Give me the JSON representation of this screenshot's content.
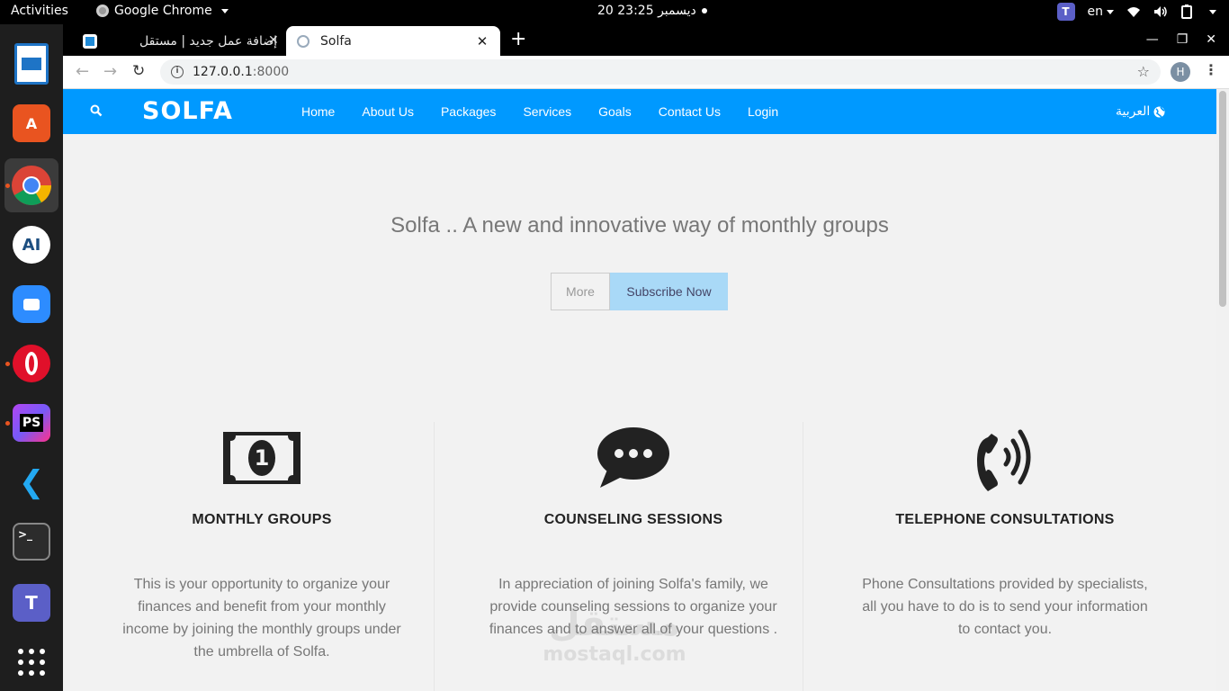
{
  "topbar": {
    "activities": "Activities",
    "app_name": "Google Chrome",
    "clock": "20 ديسمبر 23:25",
    "lang": "en"
  },
  "dock": {
    "apps": [
      "libreoffice-draw",
      "software-center",
      "google-chrome",
      "android-studio",
      "zoom",
      "opera",
      "phpstorm",
      "vscode",
      "terminal",
      "teams",
      "show-applications"
    ]
  },
  "browser": {
    "tabs": [
      {
        "title": "إضافة عمل جديد | مستقل",
        "active": false
      },
      {
        "title": "Solfa",
        "active": true
      }
    ],
    "url_host": "127.0.0.1",
    "url_port": ":8000",
    "profile_initial": "H"
  },
  "site": {
    "brand": "SOLFA",
    "nav": [
      "Home",
      "About Us",
      "Packages",
      "Services",
      "Goals",
      "Contact Us",
      "Login"
    ],
    "lang_switch": "العربية",
    "hero_title": "Solfa .. A new and innovative way of monthly groups",
    "btn_more": "More",
    "btn_subscribe": "Subscribe Now",
    "features": [
      {
        "icon": "money-bill-icon",
        "title": "MONTHLY GROUPS",
        "text": "This is your opportunity to organize your finances and benefit from your monthly income by joining the monthly groups under the umbrella of Solfa."
      },
      {
        "icon": "chat-bubble-icon",
        "title": "COUNSELING SESSIONS",
        "text": "In appreciation of joining Solfa's family, we provide counseling sessions to organize your finances and to answer all of your questions ."
      },
      {
        "icon": "phone-volume-icon",
        "title": "TELEPHONE CONSULTATIONS",
        "text": "Phone Consultations provided by specialists, all you have to do is to send your information to contact you."
      }
    ],
    "accent_color": "#0099ff"
  },
  "watermark": {
    "arabic": "مستقل",
    "latin": "mostaql.com"
  }
}
